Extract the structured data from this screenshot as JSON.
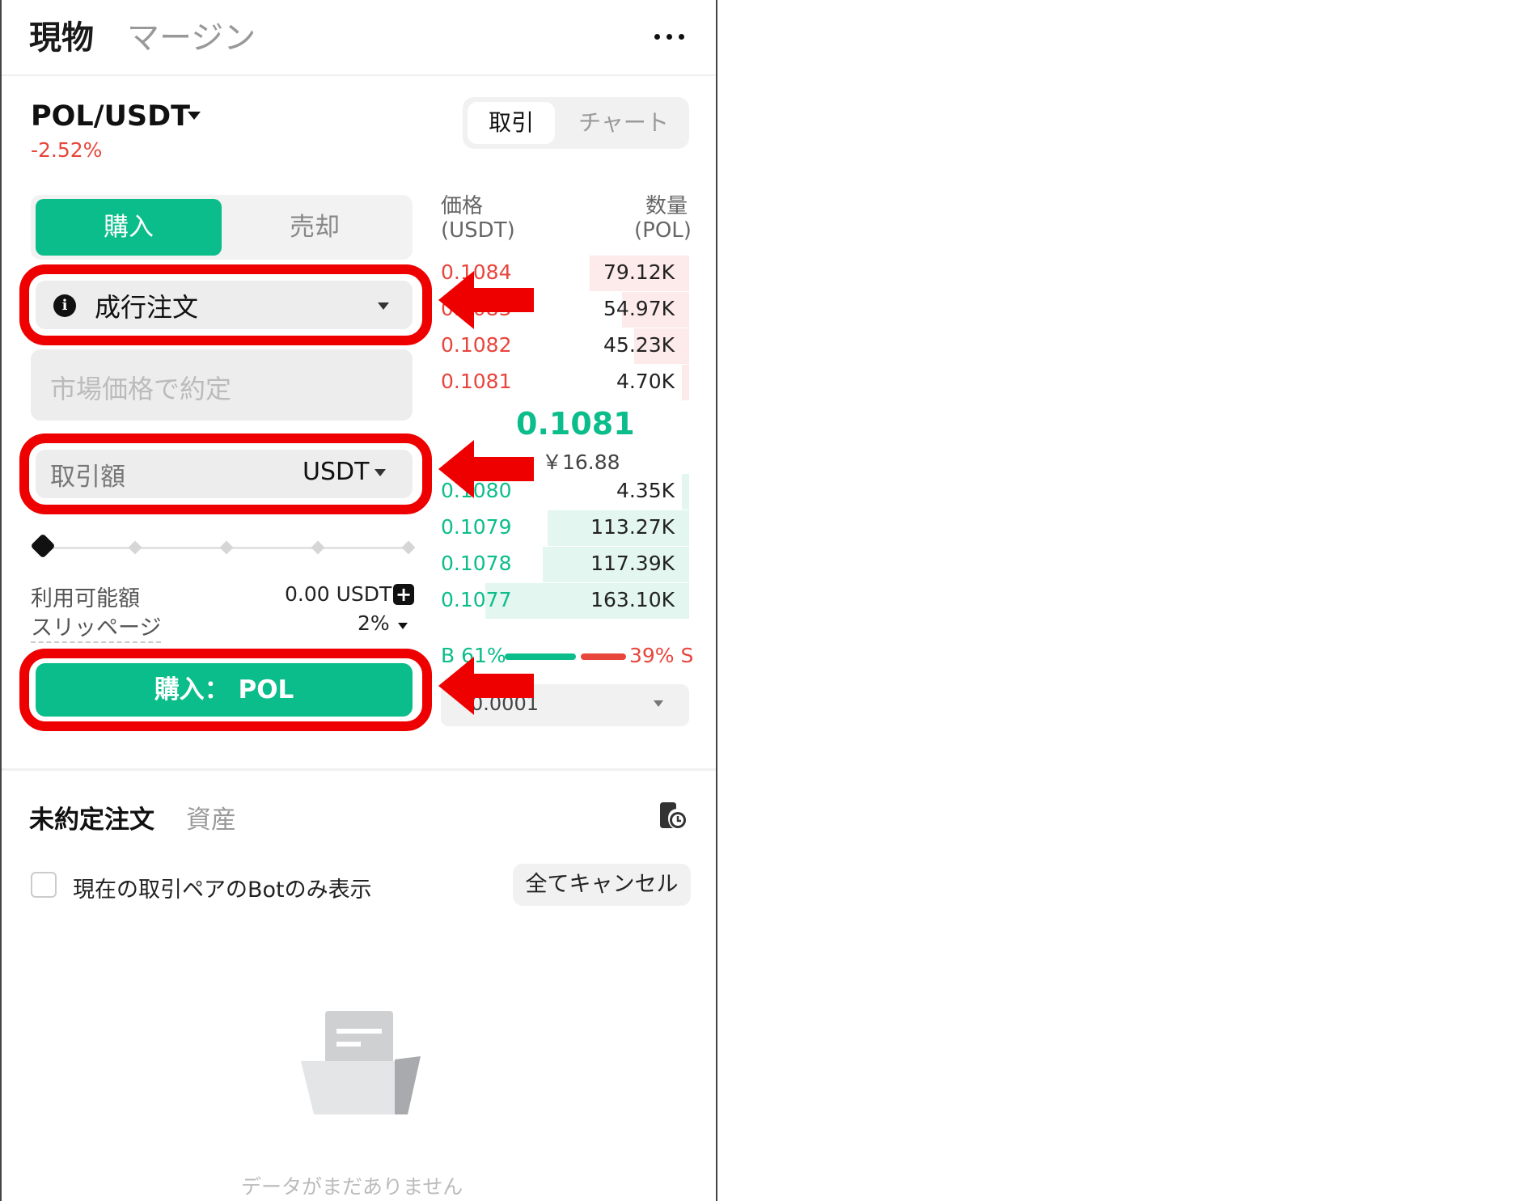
{
  "header": {
    "tabs": [
      {
        "label": "現物"
      },
      {
        "label": "マージン"
      }
    ]
  },
  "pair": {
    "symbol": "POL/USDT",
    "change": "-2.52%"
  },
  "view_toggle": {
    "active": "取引",
    "inactive": "チャート"
  },
  "trade_side": {
    "buy": "購入",
    "sell": "売却"
  },
  "order_type": {
    "label": "成行注文"
  },
  "price_field": {
    "placeholder": "市場価格で約定"
  },
  "amount_field": {
    "label": "取引額",
    "unit": "USDT"
  },
  "slider": {
    "value_percent": 0,
    "stops": 5
  },
  "info": {
    "available_label": "利用可能額",
    "available_value": "0.00 USDT",
    "slippage_label": "スリッページ",
    "slippage_value": "2%"
  },
  "submit": {
    "label": "購入： POL"
  },
  "orderbook": {
    "price_header": "価格",
    "price_unit": "(USDT)",
    "qty_header": "数量",
    "qty_unit": "(POL)",
    "asks": [
      {
        "price": "0.1084",
        "qty": "79.12K",
        "depth": 0.4
      },
      {
        "price": "0.1083",
        "qty": "54.97K",
        "depth": 0.27
      },
      {
        "price": "0.1082",
        "qty": "45.23K",
        "depth": 0.22
      },
      {
        "price": "0.1081",
        "qty": "4.70K",
        "depth": 0.03
      }
    ],
    "mid_price": "0.1081",
    "mid_fiat": "￥16.88",
    "bids": [
      {
        "price": "0.1080",
        "qty": "4.35K",
        "depth": 0.03
      },
      {
        "price": "0.1079",
        "qty": "113.27K",
        "depth": 0.57
      },
      {
        "price": "0.1078",
        "qty": "117.39K",
        "depth": 0.59
      },
      {
        "price": "0.1077",
        "qty": "163.10K",
        "depth": 0.82
      }
    ],
    "ratio_b": "B 61%",
    "ratio_s": "39% S",
    "depth_option": "0.0001"
  },
  "orders": {
    "tab_open": "未約定注文",
    "tab_assets": "資産",
    "checkbox_label": "現在の取引ペアのBotのみ表示",
    "cancel_all": "全てキャンセル",
    "empty_text": "データがまだありません"
  },
  "colors": {
    "buy": "#0bbd8a",
    "sell": "#e8453c",
    "highlight": "#ee0000"
  }
}
